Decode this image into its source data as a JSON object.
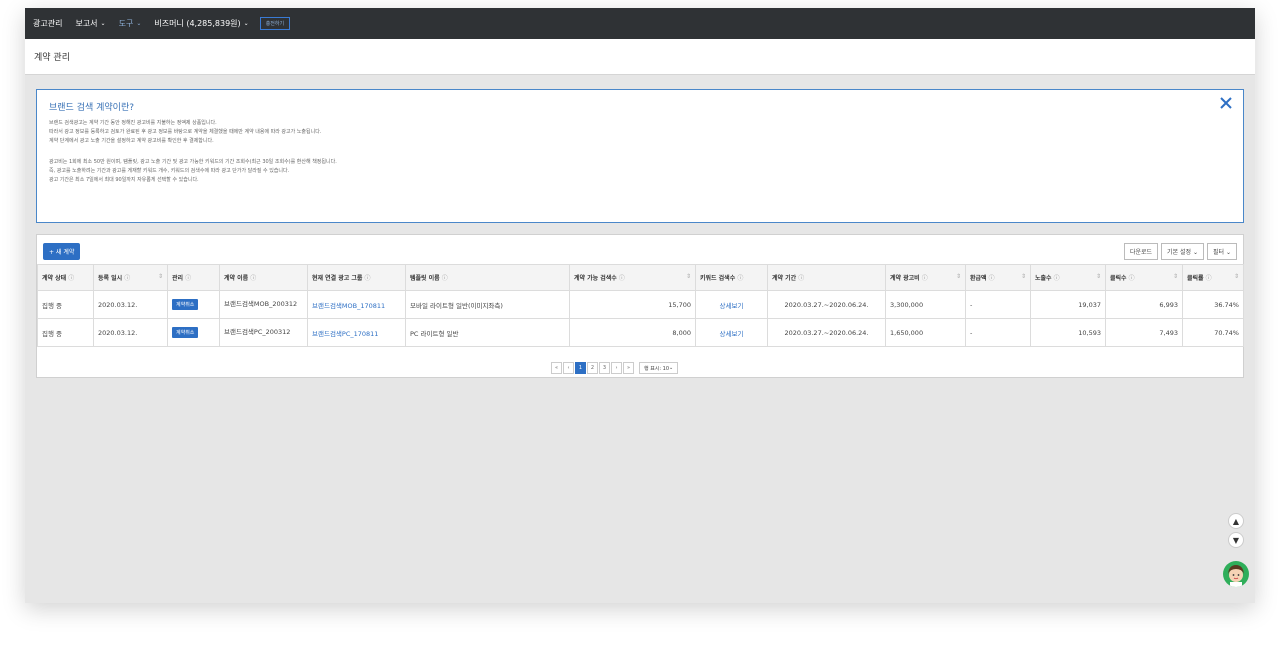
{
  "topbar": {
    "items": [
      {
        "label": "광고관리"
      },
      {
        "label": "보고서"
      },
      {
        "label": "도구"
      },
      {
        "label": "비즈머니 (4,285,839원)"
      }
    ],
    "charge_label": "충전하기",
    "active_color": "#8eb0d8"
  },
  "page_title": "계약 관리",
  "info": {
    "title": "브랜드 검색 계약이란?",
    "lines1": [
      "브랜드 검색광고는 계약 기간 동안 정해진 광고비를 지불하는 정액제 상품입니다.",
      "따라서 광고 정보를 등록하고 검토가 완료된 후 광고 정보를 바탕으로 계약을 체결했을 때에만 계약 내용에 따라 광고가 노출됩니다.",
      "계약 단계에서 광고 노출 기간을 설정하고 계약 광고비를 확인한 후 결제합니다."
    ],
    "lines2": [
      "광고비는 1회에 최소 50만 원이며, 템플릿, 광고 노출 기간 및 광고 가능한 키워드의 기간 조회수(최근 30일 조회수)를 환산해 책정됩니다.",
      "즉, 광고를 노출하려는 기간과 광고를 게재할 키워드 개수, 키워드의 검색수에 따라 광고 단가가 달라질 수 있습니다.",
      "광고 기간은 최소 7일에서 최대 90일까지 자유롭게 선택할 수 있습니다."
    ]
  },
  "toolbar": {
    "new_label": "+ 새 계약",
    "download_label": "다운로드",
    "settings_label": "기본 설정",
    "filter_label": "필터"
  },
  "table": {
    "columns": [
      "계약 상태",
      "등록 일시",
      "관리",
      "계약 이름",
      "현재 연결 광고 그룹",
      "템플릿 이름",
      "계약 가능 검색수",
      "키워드 검색수",
      "계약 기간",
      "계약 광고비",
      "환급액",
      "노출수",
      "클릭수",
      "클릭률"
    ],
    "rows": [
      {
        "status": "집행 중",
        "date": "2020.03.12.",
        "action": "계약취소",
        "name": "브랜드검색MOB_200312",
        "group": "브랜드검색MOB_170811",
        "template": "모바일 라이트형 일반(이미지좌측)",
        "searchable": "15,700",
        "kw_search": "상세보기",
        "period": "2020.03.27.~2020.06.24.",
        "cost": "3,300,000",
        "refund": "-",
        "impressions": "19,037",
        "clicks": "6,993",
        "ctr": "36.74%"
      },
      {
        "status": "집행 중",
        "date": "2020.03.12.",
        "action": "계약취소",
        "name": "브랜드검색PC_200312",
        "group": "브랜드검색PC_170811",
        "template": "PC 라이트형 일반",
        "searchable": "8,000",
        "kw_search": "상세보기",
        "period": "2020.03.27.~2020.06.24.",
        "cost": "1,650,000",
        "refund": "-",
        "impressions": "10,593",
        "clicks": "7,493",
        "ctr": "70.74%"
      }
    ]
  },
  "pager": {
    "first": "«",
    "prev": "‹",
    "pages": [
      "1",
      "2",
      "3"
    ],
    "next": "›",
    "last": "»",
    "size_label": "행 표시: 10"
  },
  "icons": {
    "close": "close-icon",
    "scroll_up": "arrow-up-icon",
    "scroll_down": "arrow-down-icon",
    "chat": "chatbot-avatar-icon"
  },
  "colors": {
    "accent": "#2d6fc4",
    "topbar": "#2f3235",
    "info_border": "#4a87c9"
  }
}
